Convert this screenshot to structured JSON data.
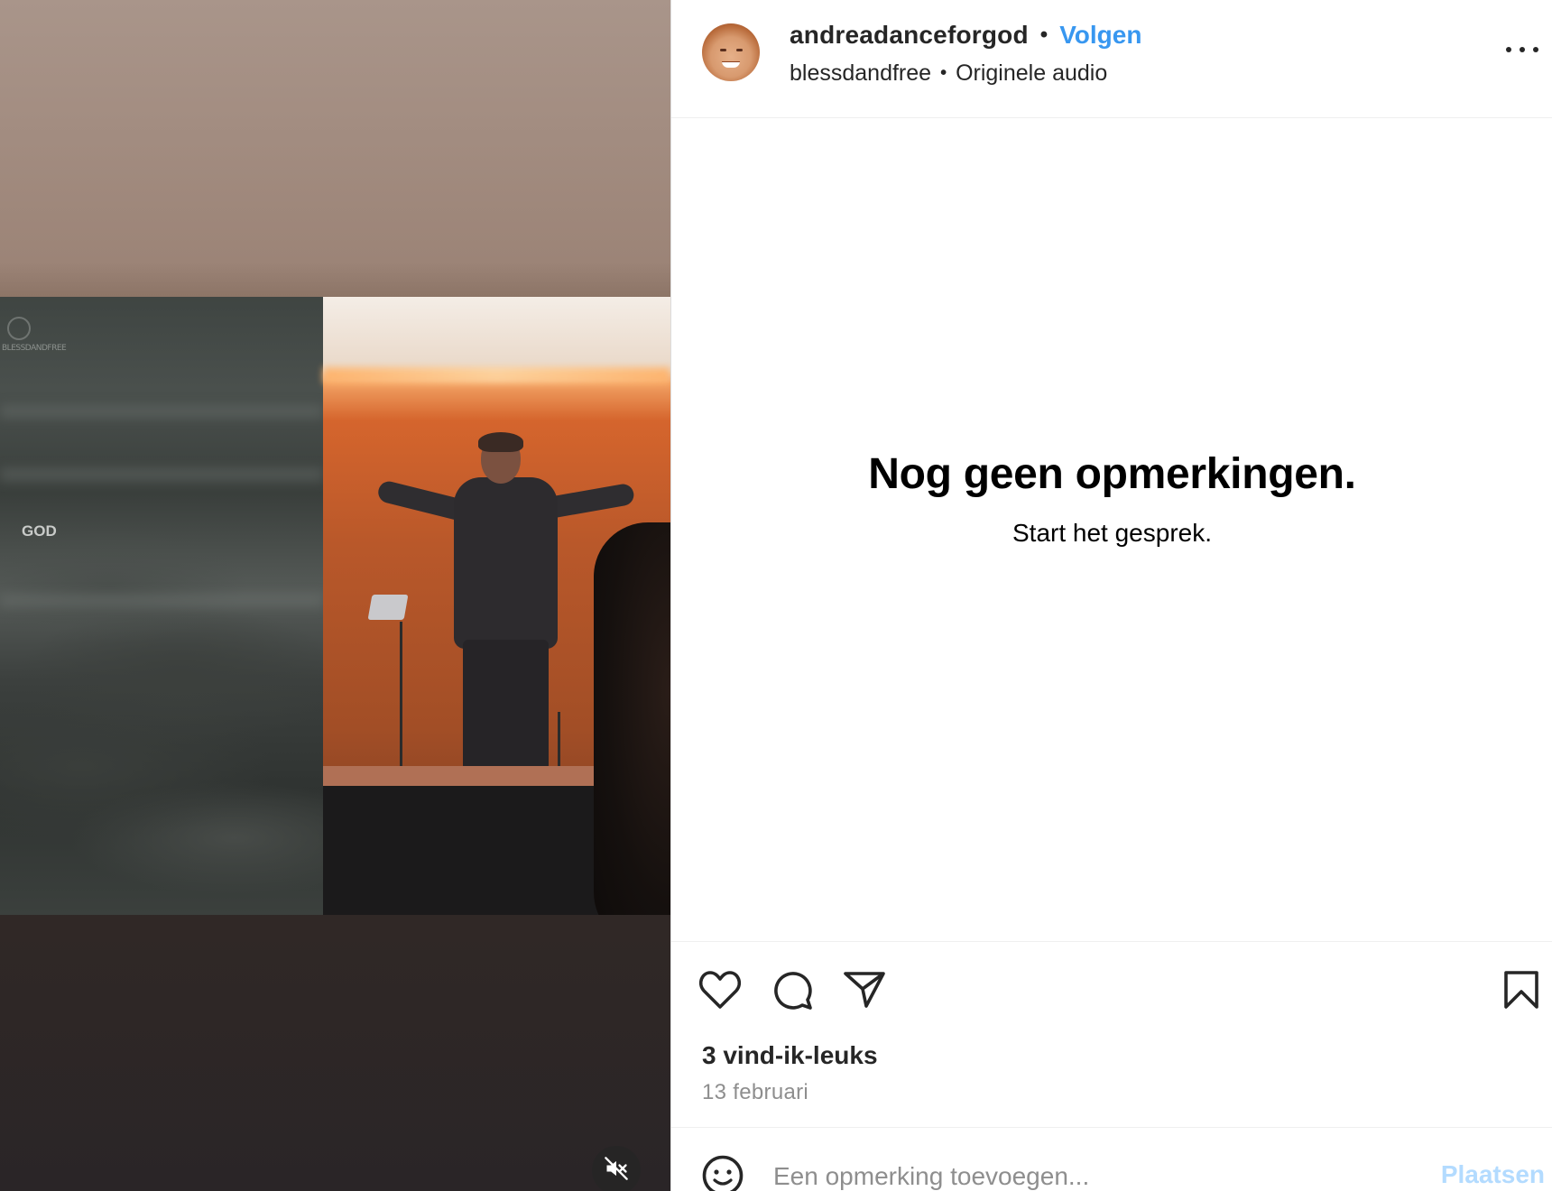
{
  "media": {
    "video_overlay_text": "GOD",
    "brand_watermark": "BLESSDANDFREE"
  },
  "header": {
    "username": "andreadanceforgod",
    "separator": "•",
    "follow_label": "Volgen",
    "audio_account": "blessdandfree",
    "audio_label": "Originele audio"
  },
  "comments": {
    "empty_title": "Nog geen opmerkingen.",
    "empty_subtitle": "Start het gesprek."
  },
  "actions": {
    "likes_text": "3 vind-ik-leuks",
    "date_text": "13 februari"
  },
  "comment_box": {
    "placeholder": "Een opmerking toevoegen...",
    "post_label": "Plaatsen"
  },
  "colors": {
    "follow": "#3897f0",
    "post_disabled": "#b3dbff",
    "secondary_text": "#8e8e8e"
  },
  "icons": [
    "heart-icon",
    "comment-icon",
    "share-icon",
    "bookmark-icon",
    "emoji-icon",
    "muted-speaker-icon",
    "more-options-icon"
  ]
}
